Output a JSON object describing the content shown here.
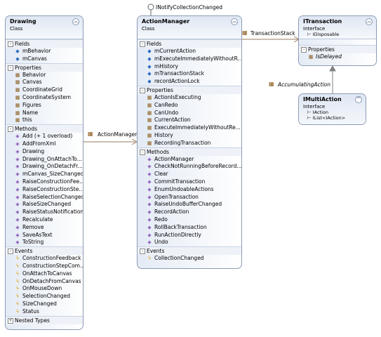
{
  "interface_lollipop": {
    "label": "INotifyCollectionChanged"
  },
  "drawing": {
    "name": "Drawing",
    "kind": "Class",
    "collapse_icon": "double-chevron-up",
    "sections": {
      "fields": {
        "title": "Fields",
        "items": [
          "mBehavior",
          "mCanvas"
        ]
      },
      "properties": {
        "title": "Properties",
        "items": [
          "Behavior",
          "Canvas",
          "CoordinateGrid",
          "CoordinateSystem",
          "Figures",
          "Name",
          "this"
        ]
      },
      "methods": {
        "title": "Methods",
        "items": [
          "Add (+ 1 overload)",
          "AddFromXml",
          "Drawing",
          "Drawing_OnAttachTo...",
          "Drawing_OnDetachFr...",
          "mCanvas_SizeChanged",
          "RaiseConstructionFee...",
          "RaiseConstructionSte...",
          "RaiseSelectionChanged",
          "RaiseSizeChanged",
          "RaiseStatusNotification",
          "Recalculate",
          "Remove",
          "SaveAsText",
          "ToString"
        ]
      },
      "events": {
        "title": "Events",
        "items": [
          "ConstructionFeedback",
          "ConstructionStepCom...",
          "OnAttachToCanvas",
          "OnDetachFromCanvas",
          "OnMouseDown",
          "SelectionChanged",
          "SizeChanged",
          "Status"
        ]
      },
      "nested": {
        "title": "Nested Types"
      }
    }
  },
  "action_manager": {
    "name": "ActionManager",
    "kind": "Class",
    "collapse_icon": "double-chevron-up",
    "sections": {
      "fields": {
        "title": "Fields",
        "items": [
          "mCurrentAction",
          "mExecuteImmediatelyWithoutR...",
          "mHistory",
          "mTransactionStack",
          "recordActionLock"
        ]
      },
      "properties": {
        "title": "Properties",
        "items": [
          "ActionIsExecuting",
          "CanRedo",
          "CanUndo",
          "CurrentAction",
          "ExecuteImmediatelyWithoutRe...",
          "History",
          "RecordingTransaction"
        ]
      },
      "methods": {
        "title": "Methods",
        "items": [
          "ActionManager",
          "CheckNotRunningBeforeRecord...",
          "Clear",
          "CommitTransaction",
          "EnumUndoableActions",
          "OpenTransaction",
          "RaiseUndoBufferChanged",
          "RecordAction",
          "Redo",
          "RollBackTransaction",
          "RunActionDirectly",
          "Undo"
        ]
      },
      "events": {
        "title": "Events",
        "items": [
          "CollectionChanged"
        ]
      }
    }
  },
  "itransaction": {
    "name": "ITransaction",
    "kind": "Interface",
    "base": "IDisposable",
    "collapse_icon": "double-chevron-up",
    "sections": {
      "properties": {
        "title": "Properties",
        "items": [
          "IsDelayed"
        ]
      }
    }
  },
  "imultiaction": {
    "name": "IMultiAction",
    "kind": "Interface",
    "bases": [
      "IAction",
      "IList<IAction>"
    ],
    "collapse_icon": "double-chevron-down"
  },
  "associations": {
    "action_manager": "ActionManager",
    "transaction_stack": "TransactionStack",
    "accumulating_action": "AccumulatingAction"
  },
  "colors": {
    "border": "#8c9bb5",
    "line": "#9a7b5e",
    "arrow_line": "#808080"
  }
}
